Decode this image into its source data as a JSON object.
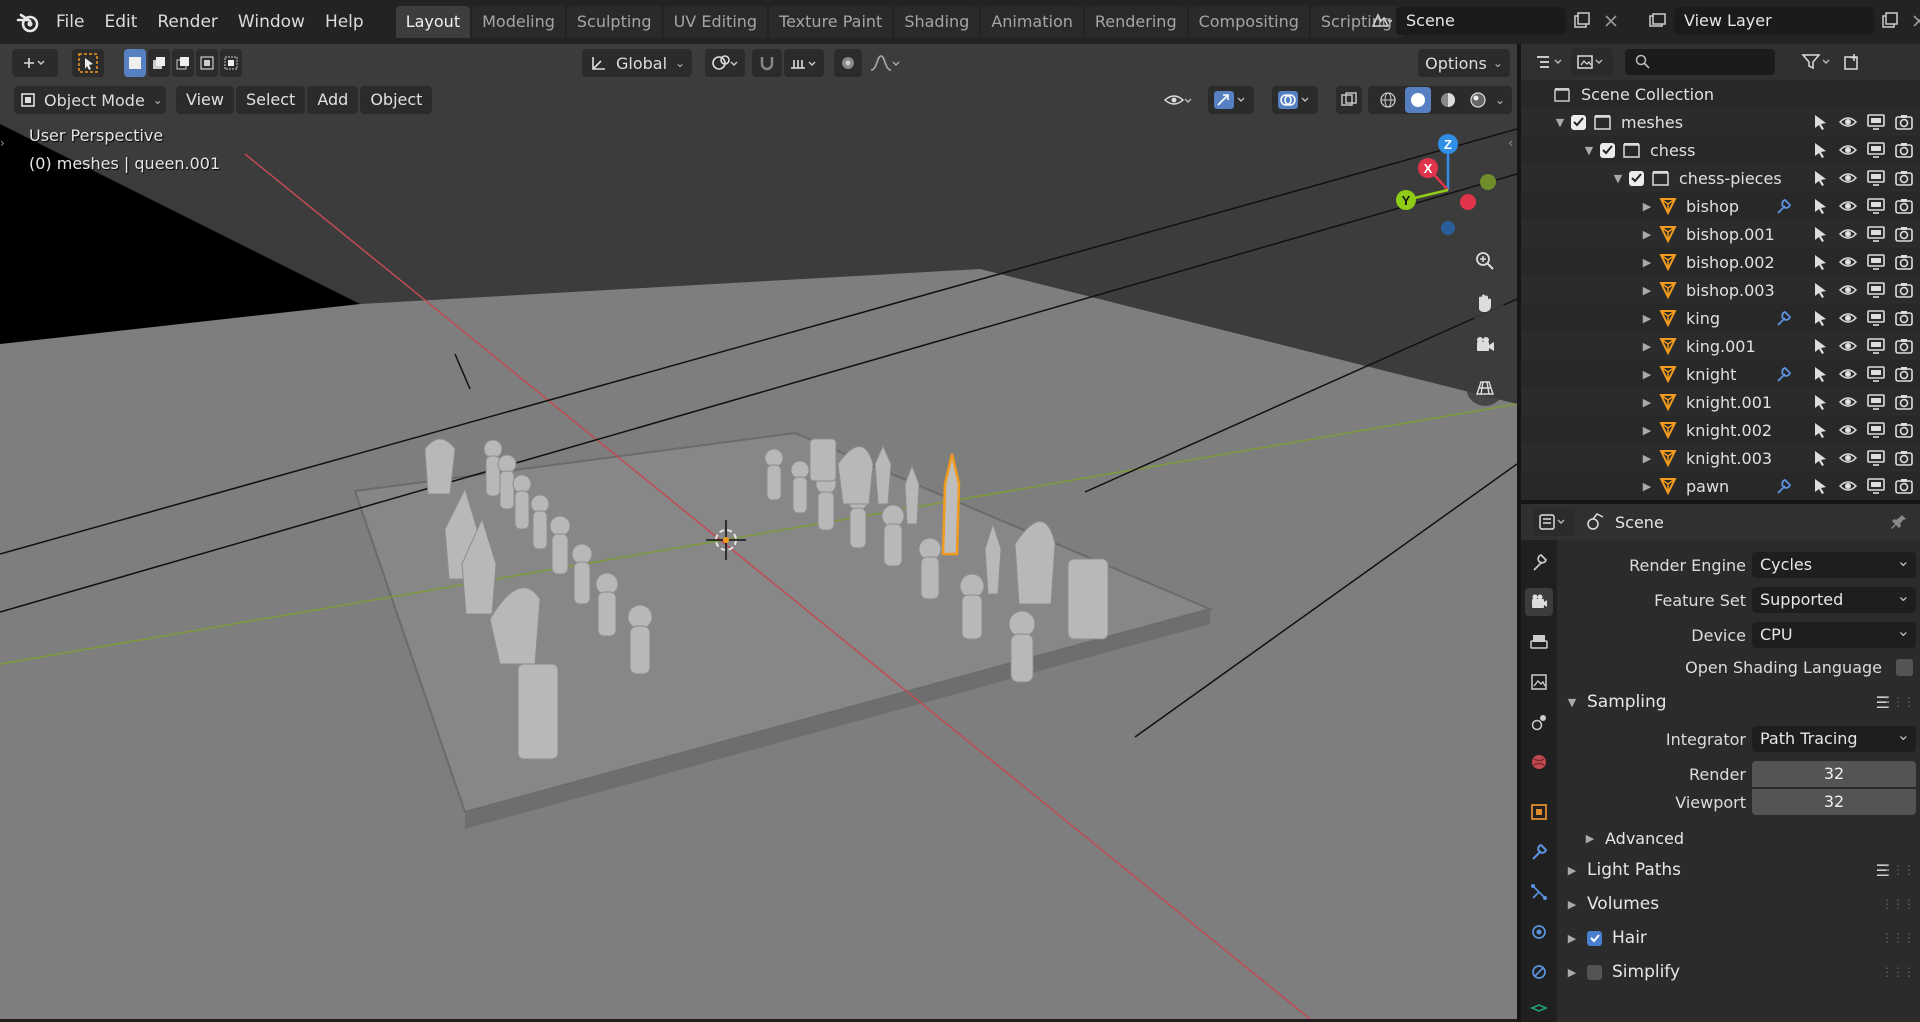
{
  "topbar": {
    "menus": [
      "File",
      "Edit",
      "Render",
      "Window",
      "Help"
    ],
    "workspaces": [
      "Layout",
      "Modeling",
      "Sculpting",
      "UV Editing",
      "Texture Paint",
      "Shading",
      "Animation",
      "Rendering",
      "Compositing",
      "Scripting"
    ],
    "active_workspace": "Layout",
    "scene_name": "Scene",
    "view_layer": "View Layer"
  },
  "viewport": {
    "header": {
      "orientation": "Global",
      "options_label": "Options",
      "mode": "Object Mode",
      "menus": [
        "View",
        "Select",
        "Add",
        "Object"
      ]
    },
    "overlay_title": "User Perspective",
    "overlay_sub": "(0) meshes | queen.001",
    "gizmo_axes": {
      "x": "X",
      "y": "Y",
      "z": "Z"
    },
    "colors": {
      "x_axis": "#e0344a",
      "y_axis": "#8ecc16",
      "z_axis": "#2f8fe6",
      "selection": "#f09a1e"
    }
  },
  "outliner": {
    "root": "Scene Collection",
    "rows": [
      {
        "label": "meshes",
        "kind": "collection",
        "indent": 0,
        "checked": true
      },
      {
        "label": "chess",
        "kind": "collection",
        "indent": 1,
        "checked": true
      },
      {
        "label": "chess-pieces",
        "kind": "collection",
        "indent": 2,
        "checked": true
      },
      {
        "label": "bishop",
        "kind": "mesh",
        "indent": 3,
        "modifier": true
      },
      {
        "label": "bishop.001",
        "kind": "mesh",
        "indent": 3
      },
      {
        "label": "bishop.002",
        "kind": "mesh",
        "indent": 3
      },
      {
        "label": "bishop.003",
        "kind": "mesh",
        "indent": 3
      },
      {
        "label": "king",
        "kind": "mesh",
        "indent": 3,
        "modifier": true
      },
      {
        "label": "king.001",
        "kind": "mesh",
        "indent": 3
      },
      {
        "label": "knight",
        "kind": "mesh",
        "indent": 3,
        "modifier": true
      },
      {
        "label": "knight.001",
        "kind": "mesh",
        "indent": 3
      },
      {
        "label": "knight.002",
        "kind": "mesh",
        "indent": 3
      },
      {
        "label": "knight.003",
        "kind": "mesh",
        "indent": 3
      },
      {
        "label": "pawn",
        "kind": "mesh",
        "indent": 3,
        "modifier": true
      }
    ]
  },
  "properties": {
    "context": "Scene",
    "render_engine": {
      "label": "Render Engine",
      "value": "Cycles"
    },
    "feature_set": {
      "label": "Feature Set",
      "value": "Supported"
    },
    "device": {
      "label": "Device",
      "value": "CPU"
    },
    "osl": {
      "label": "Open Shading Language",
      "checked": false
    },
    "sampling": {
      "title": "Sampling",
      "integrator": {
        "label": "Integrator",
        "value": "Path Tracing"
      },
      "render": {
        "label": "Render",
        "value": "32"
      },
      "viewport": {
        "label": "Viewport",
        "value": "32"
      },
      "advanced": "Advanced"
    },
    "panels": {
      "light_paths": "Light Paths",
      "volumes": "Volumes",
      "hair": "Hair",
      "simplify": "Simplify"
    },
    "hair_checked": true,
    "simplify_checked": false
  }
}
